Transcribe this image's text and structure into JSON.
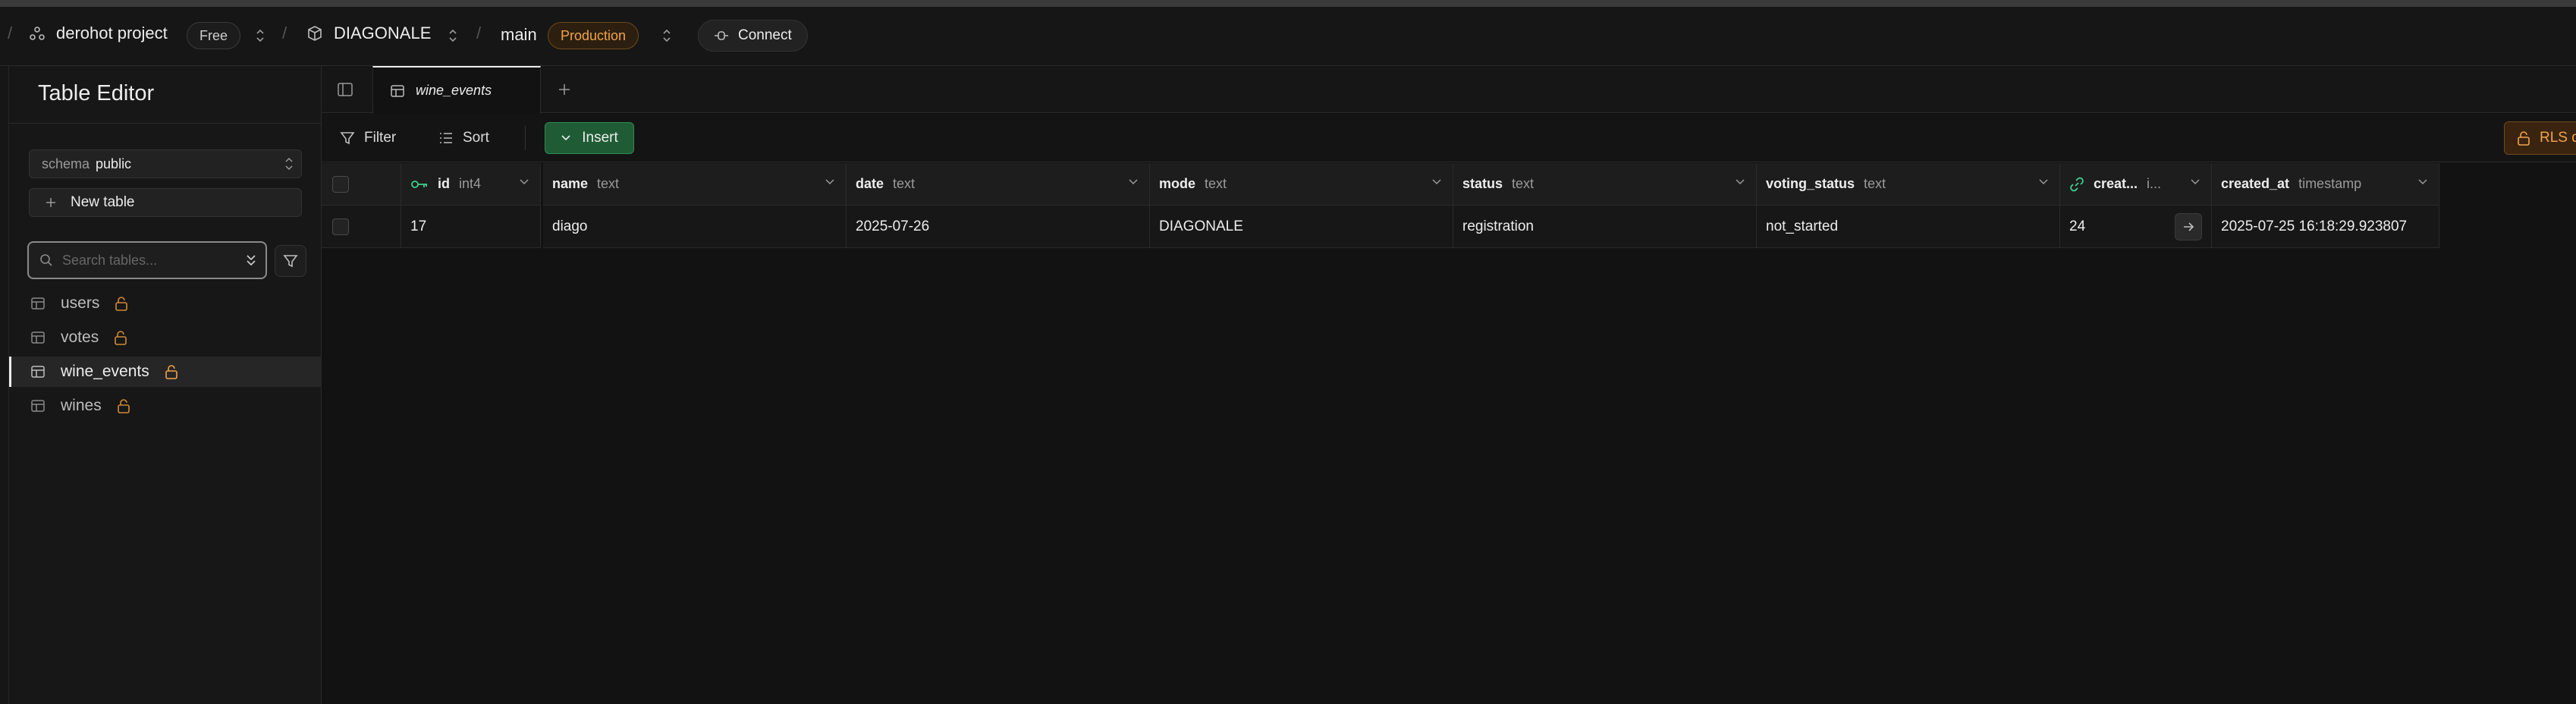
{
  "topbar": {
    "org": "derohot project",
    "plan": "Free",
    "project": "DIAGONALE",
    "branch": "main",
    "env_badge": "Production",
    "connect_label": "Connect"
  },
  "sidebar": {
    "title": "Table Editor",
    "schema_key": "schema",
    "schema_value": "public",
    "new_table_label": "New table",
    "search_placeholder": "Search tables...",
    "tables": [
      {
        "name": "users",
        "active": false
      },
      {
        "name": "votes",
        "active": false
      },
      {
        "name": "wine_events",
        "active": true
      },
      {
        "name": "wines",
        "active": false
      }
    ]
  },
  "tabs": {
    "active_tab": "wine_events"
  },
  "toolbar": {
    "filter_label": "Filter",
    "sort_label": "Sort",
    "insert_label": "Insert",
    "rls_label": "RLS d"
  },
  "grid": {
    "columns": [
      {
        "name": "id",
        "type": "int4",
        "icon": "key-icon"
      },
      {
        "name": "name",
        "type": "text"
      },
      {
        "name": "date",
        "type": "text"
      },
      {
        "name": "mode",
        "type": "text"
      },
      {
        "name": "status",
        "type": "text"
      },
      {
        "name": "voting_status",
        "type": "text"
      },
      {
        "name": "creat...",
        "type": "i...",
        "icon": "link-icon"
      },
      {
        "name": "created_at",
        "type": "timestamp"
      }
    ],
    "rows": [
      {
        "id": "17",
        "name": "diago",
        "date": "2025-07-26",
        "mode": "DIAGONALE",
        "status": "registration",
        "voting_status": "not_started",
        "created_by": "24",
        "created_at": "2025-07-25 16:18:29.923807"
      }
    ]
  },
  "colors": {
    "background": "#121212",
    "accent_green": "#1f5c36",
    "warning_orange": "#f0a44a"
  }
}
